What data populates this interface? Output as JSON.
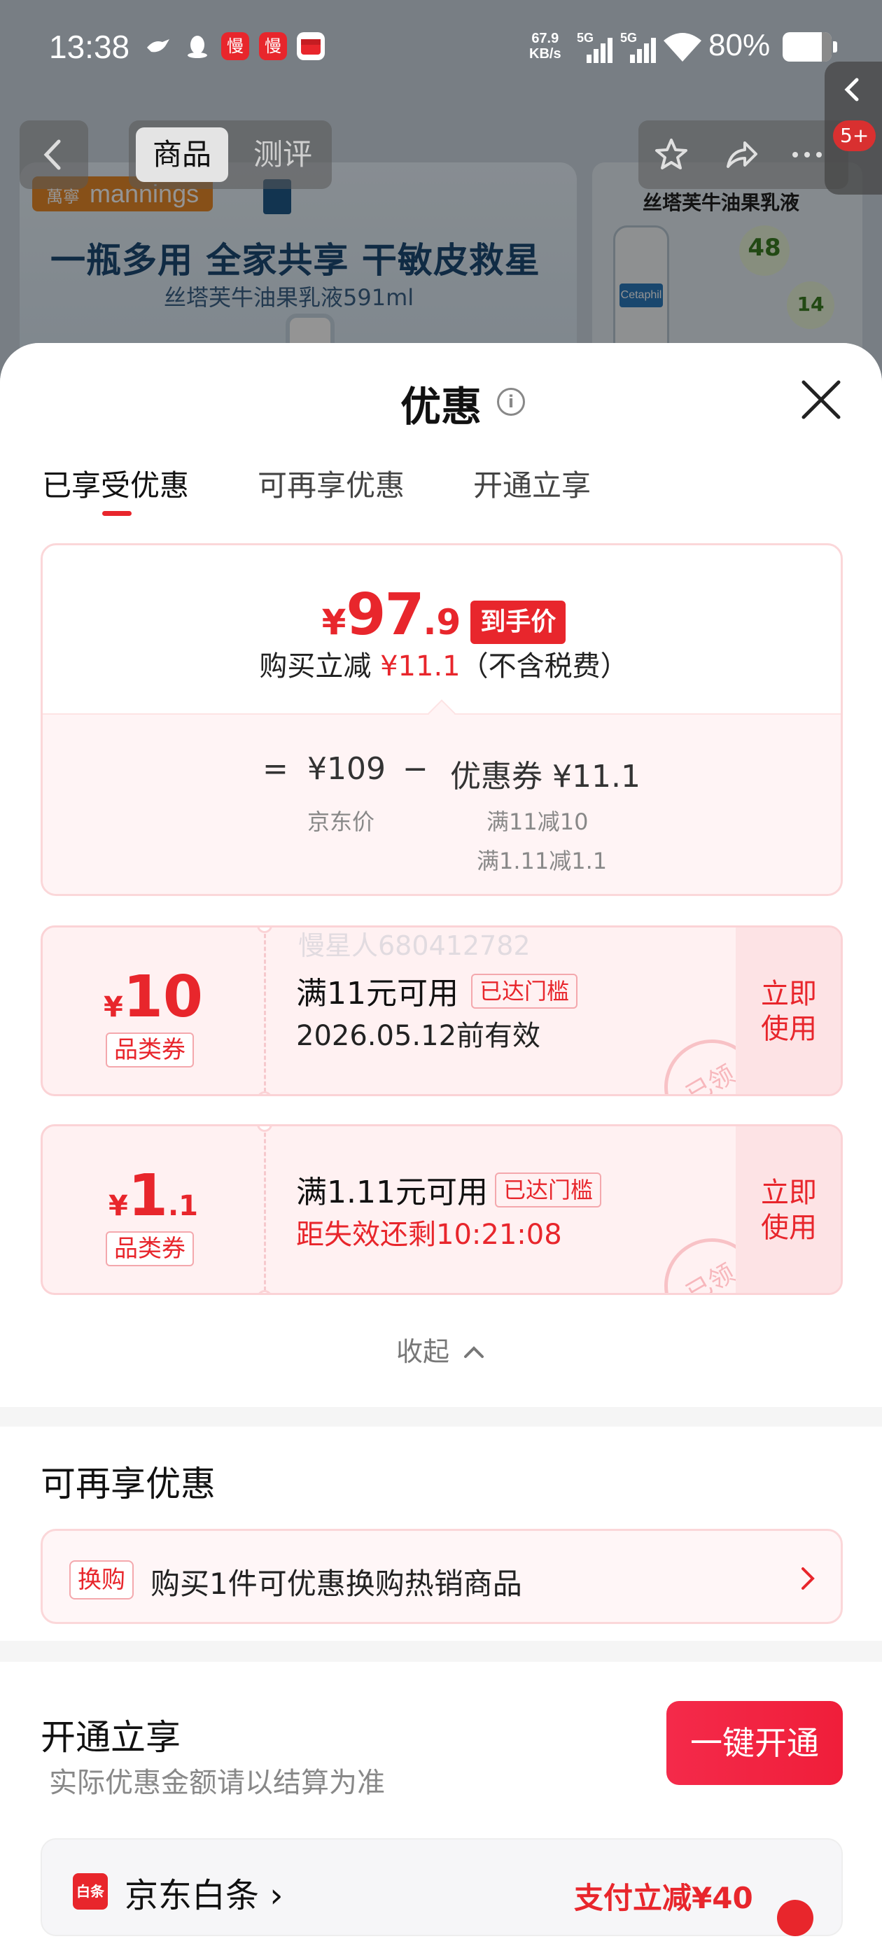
{
  "status_bar": {
    "time": "13:38",
    "net_speed_value": "67.9",
    "net_speed_unit": "KB/s",
    "signal_1": "5G",
    "signal_2": "5G",
    "battery": "80%",
    "app_icons": [
      "dove-icon",
      "qq-icon",
      "app-slow-icon",
      "app-slow-icon",
      "wallet-icon"
    ],
    "app_icon_labels": [
      "慢",
      "慢"
    ]
  },
  "nav": {
    "tab_product": "商品",
    "tab_review": "测评",
    "side_badge": "5+"
  },
  "banner": {
    "brand": "mannings",
    "brand_cn": "萬寧",
    "headline": "一瓶多用 全家共享 干敏皮救星",
    "subline": "丝塔芙牛油果乳液591ml",
    "side_title": "丝塔芙牛油果乳液",
    "side_label": "Cetaphil",
    "side_badge_48": "48",
    "side_badge_14": "14"
  },
  "sheet": {
    "title": "优惠",
    "tabs": [
      "已享受优惠",
      "可再享优惠",
      "开通立享"
    ],
    "summary": {
      "price_symbol": "¥",
      "price_int": "97",
      "price_dec": ".9",
      "price_tag": "到手价",
      "reduce_prefix": "购买立减",
      "reduce_amount": "¥11.1",
      "reduce_suffix": "（不含税费）",
      "eq": "=",
      "jd_price": "¥109",
      "minus": "−",
      "coupon_total": "优惠券 ¥11.1",
      "jd_price_label": "京东价",
      "coupon_detail_1": "满11减10",
      "coupon_detail_2": "满1.11减1.1"
    },
    "coupons": [
      {
        "symbol": "¥",
        "amount_int": "10",
        "amount_dec": "",
        "category": "品类券",
        "title": "满11元可用",
        "threshold": "已达门槛",
        "validity": "2026.05.12前有效",
        "use_label": "立即使用",
        "stamp": "已领"
      },
      {
        "symbol": "¥",
        "amount_int": "1",
        "amount_dec": ".1",
        "category": "品类券",
        "title": "满1.11元可用",
        "threshold": "已达门槛",
        "validity": "距失效还剩10:21:08",
        "use_label": "立即使用",
        "stamp": "已领"
      }
    ],
    "watermark": "慢星人680412782",
    "collapse_label": "收起"
  },
  "more_offers": {
    "title": "可再享优惠",
    "tag": "换购",
    "text": "购买1件可优惠换购热销商品"
  },
  "open_offers": {
    "title": "开通立享",
    "subtitle": "实际优惠金额请以结算为准",
    "button": "一键开通",
    "baitiao_logo": "白条",
    "baitiao_name": "京东白条",
    "baitiao_pay": "支付立减¥40"
  },
  "colors": {
    "accent": "#e8262c",
    "accent_soft": "#fff1f2"
  }
}
